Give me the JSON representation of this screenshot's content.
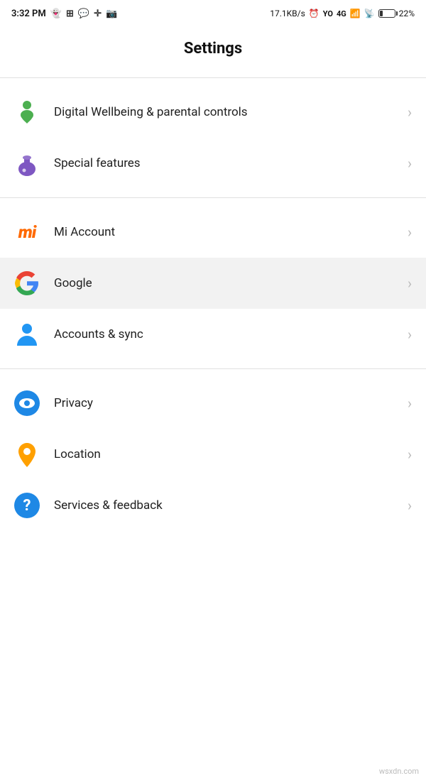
{
  "statusBar": {
    "time": "3:32 PM",
    "networkSpeed": "17.1KB/s",
    "batteryPercent": "22%"
  },
  "pageTitle": "Settings",
  "sections": [
    {
      "id": "wellbeing-section",
      "items": [
        {
          "id": "digital-wellbeing",
          "label": "Digital Wellbeing & parental controls",
          "iconType": "wellbeing",
          "active": false
        },
        {
          "id": "special-features",
          "label": "Special features",
          "iconType": "special",
          "active": false
        }
      ]
    },
    {
      "id": "accounts-section",
      "items": [
        {
          "id": "mi-account",
          "label": "Mi Account",
          "iconType": "mi",
          "active": false
        },
        {
          "id": "google",
          "label": "Google",
          "iconType": "google",
          "active": true
        },
        {
          "id": "accounts-sync",
          "label": "Accounts & sync",
          "iconType": "accounts",
          "active": false
        }
      ]
    },
    {
      "id": "privacy-section",
      "items": [
        {
          "id": "privacy",
          "label": "Privacy",
          "iconType": "privacy",
          "active": false
        },
        {
          "id": "location",
          "label": "Location",
          "iconType": "location",
          "active": false
        },
        {
          "id": "services-feedback",
          "label": "Services & feedback",
          "iconType": "services",
          "active": false
        }
      ]
    }
  ],
  "watermark": "wsxdn.com"
}
